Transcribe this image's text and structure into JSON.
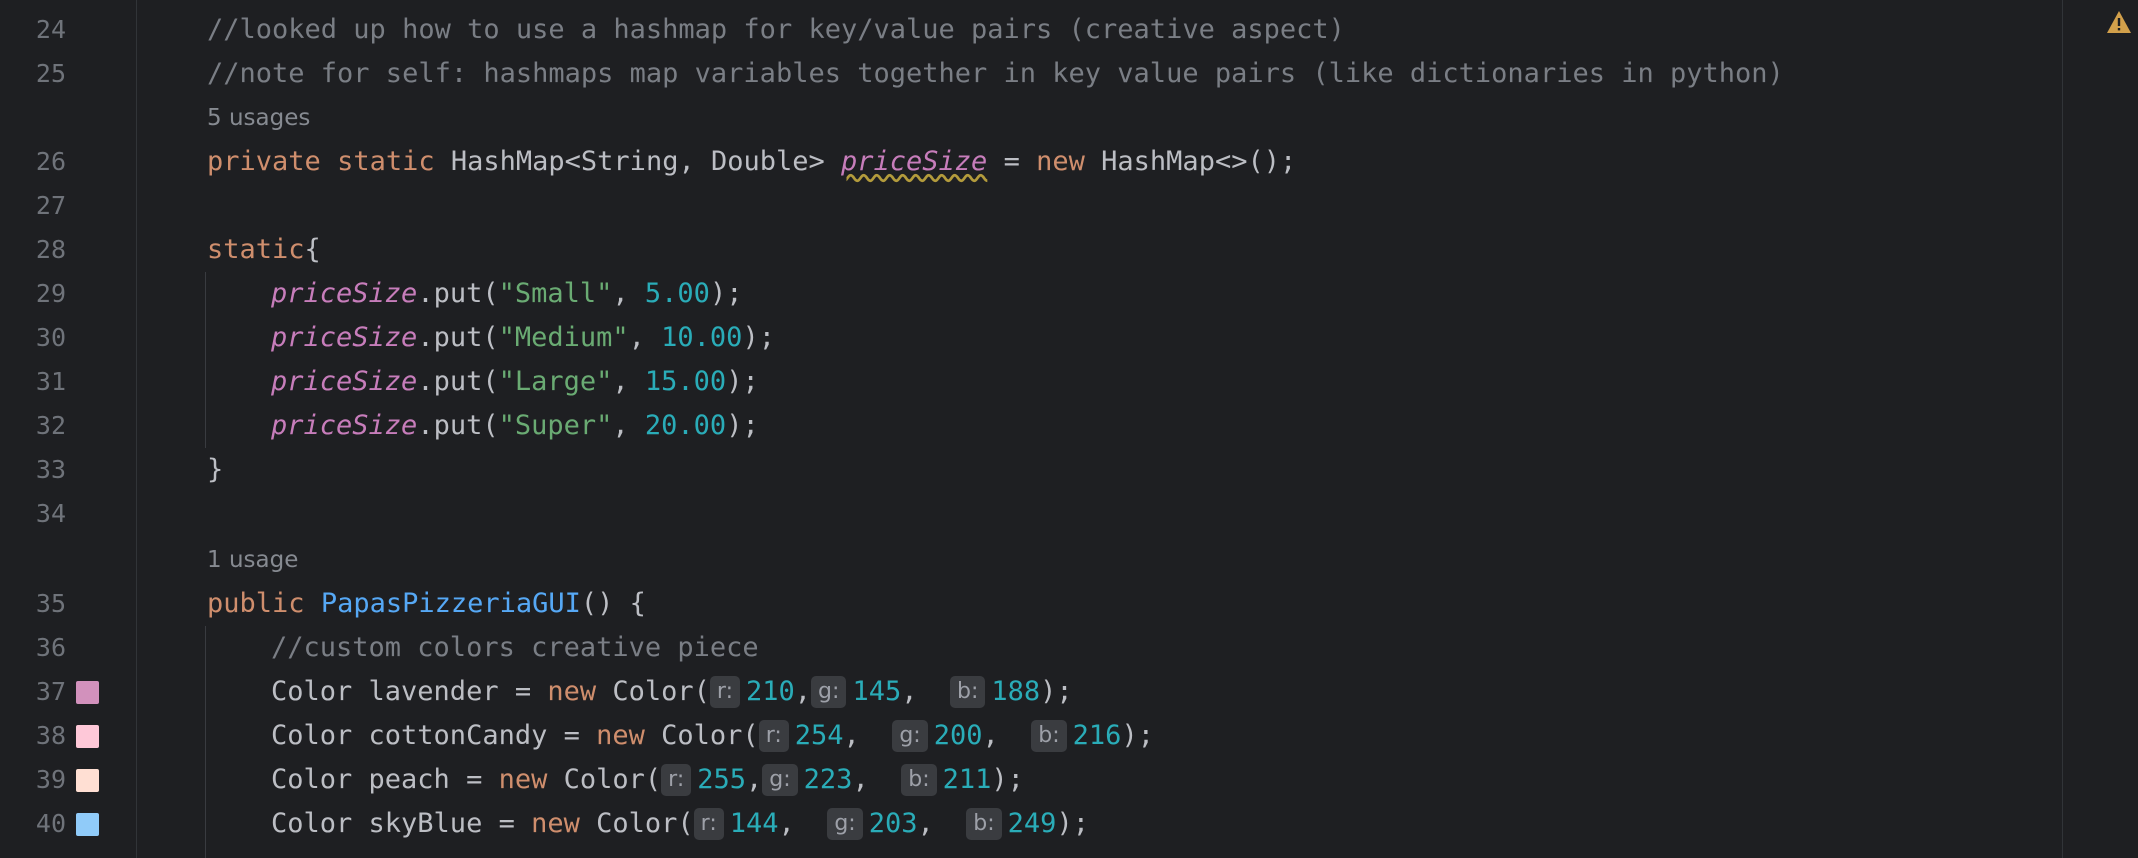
{
  "gutter": {
    "line_numbers": [
      "24",
      "25",
      "26",
      "27",
      "28",
      "29",
      "30",
      "31",
      "32",
      "33",
      "34",
      "35",
      "36",
      "37",
      "38",
      "39",
      "40"
    ]
  },
  "swatches": {
    "lavender": "#d291bc",
    "cottonCandy": "#fec8d8",
    "peach": "#ffdfd3",
    "skyBlue": "#90cbf9"
  },
  "warning_icon": "warning-triangle-icon",
  "code": {
    "line24": "//looked up how to use a hashmap for key/value pairs (creative aspect)",
    "line25": "//note for self: hashmaps map variables together in key value pairs (like dictionaries in python)",
    "usage_price_size": "5 usages",
    "line26": {
      "private": "private",
      "sp1": " ",
      "static": "static",
      "sp2": " ",
      "type": "HashMap<String, Double>",
      "sp3": " ",
      "field": "priceSize",
      "eq": " = ",
      "new": "new",
      "sp4": " ",
      "ctor": "HashMap<>();"
    },
    "line28": {
      "static": "static",
      "brace": "{"
    },
    "line29": {
      "field": "priceSize",
      "call": ".put(",
      "str": "\"Small\"",
      "comma": ", ",
      "num": "5.00",
      "end": ");"
    },
    "line30": {
      "field": "priceSize",
      "call": ".put(",
      "str": "\"Medium\"",
      "comma": ", ",
      "num": "10.00",
      "end": ");"
    },
    "line31": {
      "field": "priceSize",
      "call": ".put(",
      "str": "\"Large\"",
      "comma": ", ",
      "num": "15.00",
      "end": ");"
    },
    "line32": {
      "field": "priceSize",
      "call": ".put(",
      "str": "\"Super\"",
      "comma": ", ",
      "num": "20.00",
      "end": ");"
    },
    "line33": "}",
    "usage_ctor": "1 usage",
    "line35": {
      "public": "public",
      "sp": " ",
      "name": "PapasPizzeriaGUI",
      "rest": "() {"
    },
    "line36": "//custom colors creative piece",
    "hints": {
      "r": "r:",
      "g": "g:",
      "b": "b:"
    },
    "line37": {
      "decl": "Color lavender = ",
      "new": "new",
      "ctor": " Color(",
      "r": "210",
      "sep1": ",",
      "g": "145",
      "sep2": ",  ",
      "b": "188",
      "end": ");"
    },
    "line38": {
      "decl": "Color cottonCandy = ",
      "new": "new",
      "ctor": " Color(",
      "r": "254",
      "sep1": ",  ",
      "g": "200",
      "sep2": ",  ",
      "b": "216",
      "end": ");"
    },
    "line39": {
      "decl": "Color peach = ",
      "new": "new",
      "ctor": " Color(",
      "r": "255",
      "sep1": ",",
      "g": "223",
      "sep2": ",  ",
      "b": "211",
      "end": ");"
    },
    "line40": {
      "decl": "Color skyBlue = ",
      "new": "new",
      "ctor": " Color(",
      "r": "144",
      "sep1": ",  ",
      "g": "203",
      "sep2": ",  ",
      "b": "249",
      "end": ");"
    }
  }
}
